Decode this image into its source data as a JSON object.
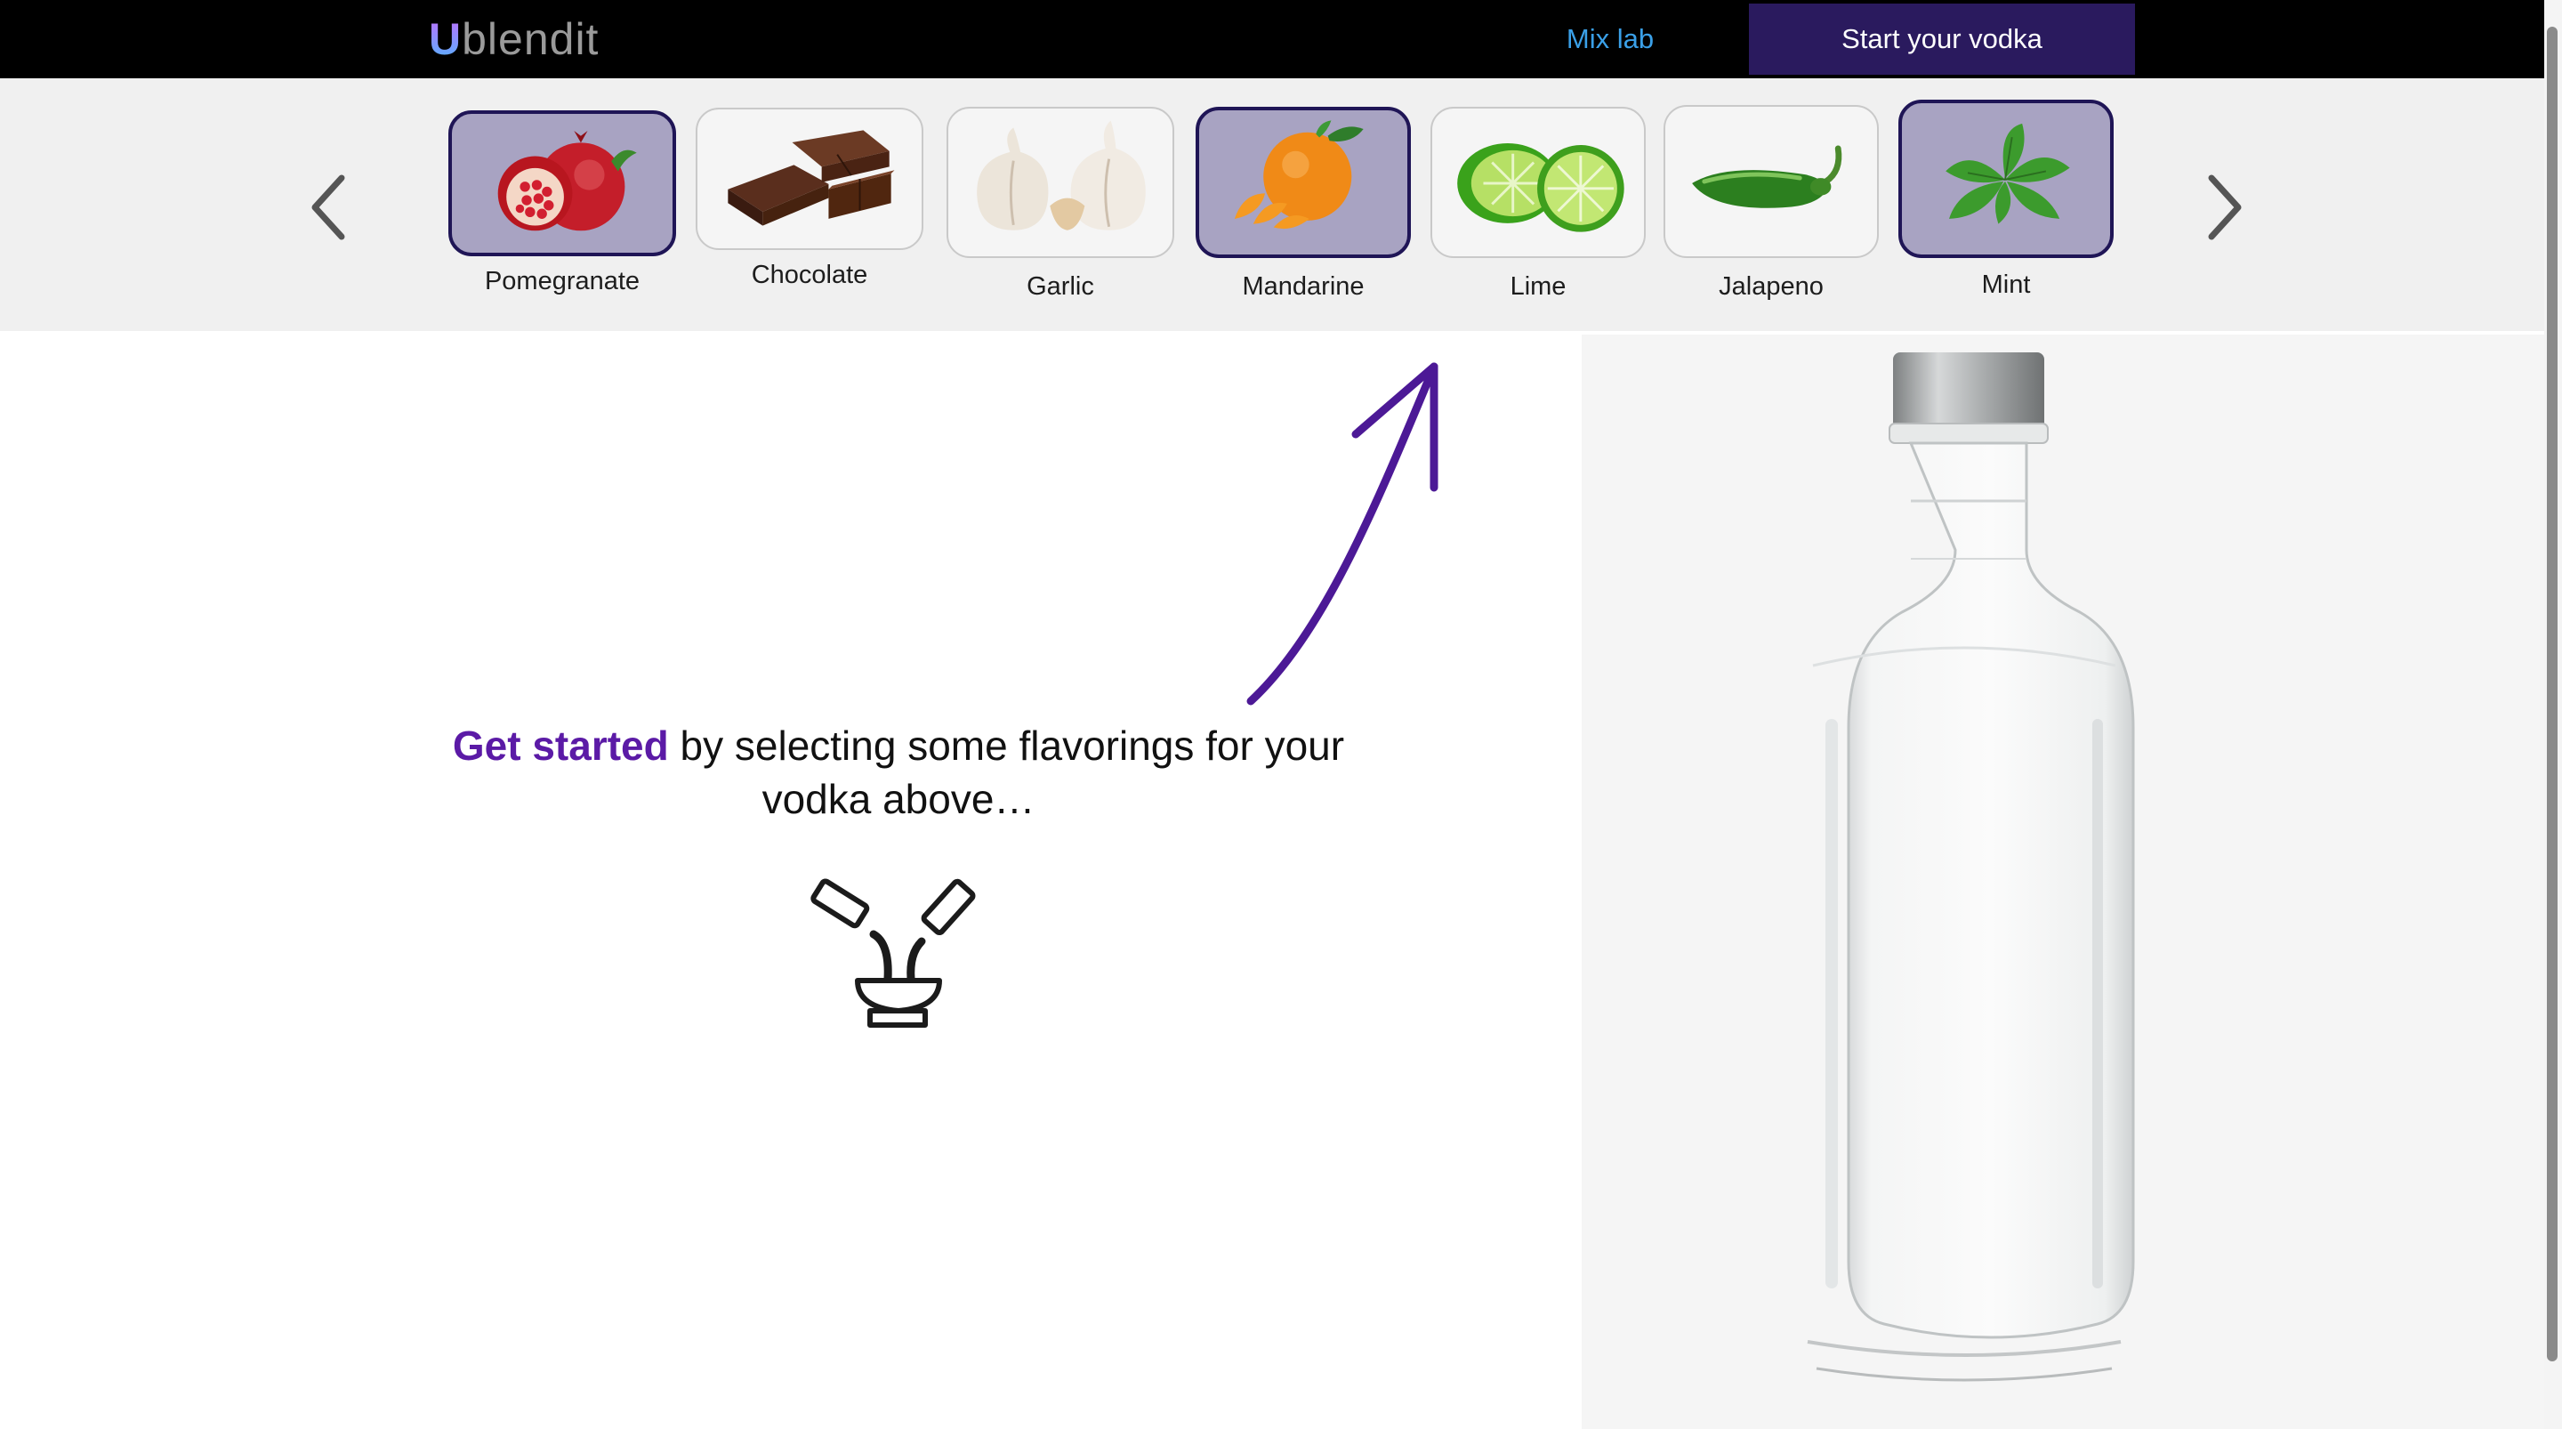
{
  "header": {
    "logo_first_letter": "U",
    "logo_rest": "blendit",
    "nav": {
      "mix_lab": "Mix lab",
      "start_vodka": "Start your vodka"
    }
  },
  "carousel": {
    "prev_icon": "chevron-left-icon",
    "next_icon": "chevron-right-icon",
    "flavors": [
      {
        "label": "Pomegranate",
        "selected": true
      },
      {
        "label": "Chocolate",
        "selected": false
      },
      {
        "label": "Garlic",
        "selected": false
      },
      {
        "label": "Mandarine",
        "selected": true
      },
      {
        "label": "Lime",
        "selected": false
      },
      {
        "label": "Jalapeno",
        "selected": false
      },
      {
        "label": "Mint",
        "selected": true
      }
    ]
  },
  "main": {
    "cta_strong": "Get started",
    "cta_rest": " by selecting some flavorings for your vodka above…",
    "icon": "pour-mix-icon"
  },
  "colors": {
    "accent": "#5b1aa6",
    "nav_active_bg": "#2a1a5e",
    "nav_link": "#3aa0e8",
    "selected_tile_bg": "#a8a3c2"
  }
}
